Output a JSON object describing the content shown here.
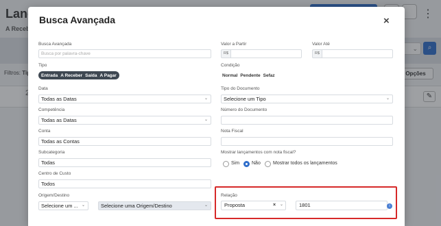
{
  "background": {
    "title": "Lança",
    "subtitle": "A Receb",
    "filtros_label": "Filtros:",
    "filtros_value": "Tip",
    "opcoes_label": "Opções",
    "row_text": "2"
  },
  "modal": {
    "title": "Busca Avançada",
    "close_glyph": "×"
  },
  "left": {
    "busca_label": "Busca Avançada",
    "busca_placeholder": "Busca por palavra-chave",
    "tipo_label": "Tipo",
    "tipo_options": [
      "Entrada",
      "A Receber",
      "Saída",
      "A Pagar"
    ],
    "data_label": "Data",
    "data_value": "Todas as Datas",
    "competencia_label": "Competência",
    "competencia_value": "Todas as Datas",
    "conta_label": "Conta",
    "conta_value": "Todas as Contas",
    "subcategoria_label": "Subcategoria",
    "subcategoria_value": "Todas",
    "centro_label": "Centro de Custo",
    "centro_value": "Todos",
    "origem_label": "Origem/Destino",
    "origem_value": "Selecione um ...",
    "origem_value2": "Selecione uma Origem/Destino"
  },
  "right": {
    "valor_partir_label": "Valor a Partir",
    "valor_ate_label": "Valor Até",
    "currency_prefix": "R$",
    "condicao_label": "Condição",
    "condicao_options": [
      "Normal",
      "Pendente",
      "Sefaz"
    ],
    "tipo_doc_label": "Tipo do Documento",
    "tipo_doc_value": "Selecione um Tipo",
    "numero_doc_label": "Número do Documento",
    "nota_fiscal_label": "Nota Fiscal",
    "mostrar_label": "Mostrar lançamentos com nota fiscal?",
    "mostrar_options": [
      "Sim",
      "Não",
      "Mostrar todos os lançamentos"
    ],
    "mostrar_selected": "Não",
    "relacao_label": "Relação",
    "relacao_value": "Proposta",
    "relacao_number": "1801"
  }
}
